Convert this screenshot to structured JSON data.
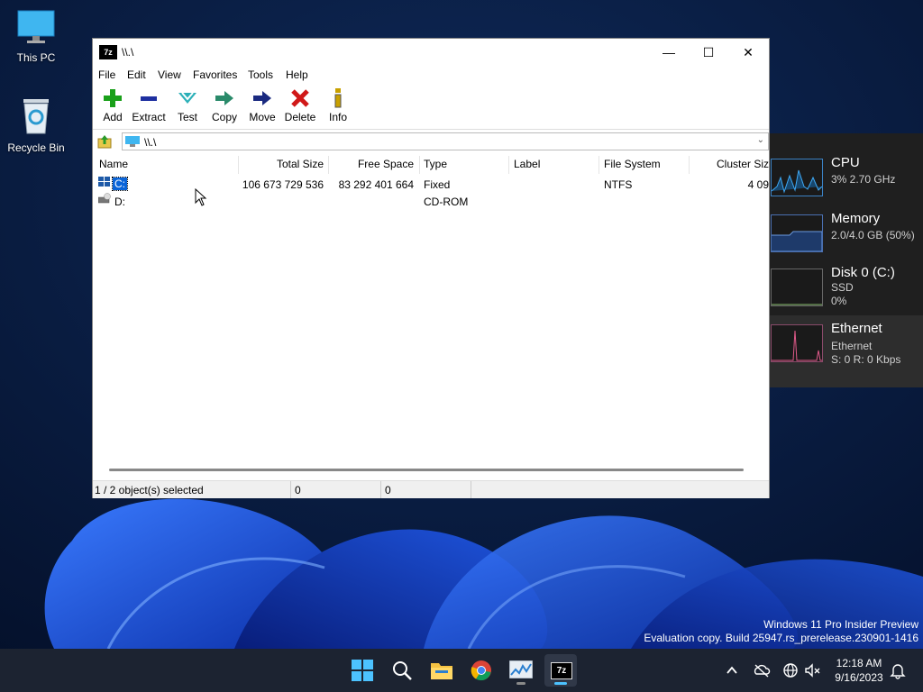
{
  "desktop": {
    "icons": [
      {
        "label": "This PC"
      },
      {
        "label": "Recycle Bin"
      }
    ]
  },
  "perf": {
    "cpu": {
      "title": "CPU",
      "sub": "3% 2.70 GHz"
    },
    "memory": {
      "title": "Memory",
      "sub": "2.0/4.0 GB (50%)"
    },
    "disk": {
      "title": "Disk 0 (C:)",
      "sub1": "SSD",
      "sub2": "0%"
    },
    "ethernet": {
      "title": "Ethernet",
      "sub1": "Ethernet",
      "sub2": "S: 0 R: 0 Kbps"
    }
  },
  "window": {
    "app_icon": "7z",
    "title": "\\\\.\\",
    "controls": {
      "minimize": "—",
      "maximize": "☐",
      "close": "✕"
    },
    "menu": [
      "File",
      "Edit",
      "View",
      "Favorites",
      "Tools",
      "Help"
    ],
    "toolbar": [
      {
        "label": "Add",
        "icon": "plus-icon",
        "color": "#1aa01a"
      },
      {
        "label": "Extract",
        "icon": "minus-icon",
        "color": "#1e2fa0"
      },
      {
        "label": "Test",
        "icon": "check-icon",
        "color": "#2bb0b8"
      },
      {
        "label": "Copy",
        "icon": "copy-arrow-icon",
        "color": "#2a8a6a"
      },
      {
        "label": "Move",
        "icon": "move-arrow-icon",
        "color": "#1a2a80"
      },
      {
        "label": "Delete",
        "icon": "x-icon",
        "color": "#d01818"
      },
      {
        "label": "Info",
        "icon": "info-icon",
        "color": "#c8a000"
      }
    ],
    "address": "\\\\.\\",
    "columns": [
      "Name",
      "Total Size",
      "Free Space",
      "Type",
      "Label",
      "File System",
      "Cluster Siz"
    ],
    "rows": [
      {
        "name": "C:",
        "total": "106 673 729 536",
        "free": "83 292 401 664",
        "type": "Fixed",
        "label": "",
        "fs": "NTFS",
        "cluster": "4 09",
        "selected": true
      },
      {
        "name": "D:",
        "total": "",
        "free": "",
        "type": "CD-ROM",
        "label": "",
        "fs": "",
        "cluster": "",
        "selected": false
      }
    ],
    "status": {
      "selection": "1 / 2 object(s) selected",
      "size": "0",
      "packed": "0"
    }
  },
  "watermark": {
    "line1": "Windows 11 Pro Insider Preview",
    "line2": "Evaluation copy. Build 25947.rs_prerelease.230901-1416"
  },
  "taskbar": {
    "time": "12:18 AM",
    "date": "9/16/2023",
    "accent": "#4cc2ff"
  }
}
